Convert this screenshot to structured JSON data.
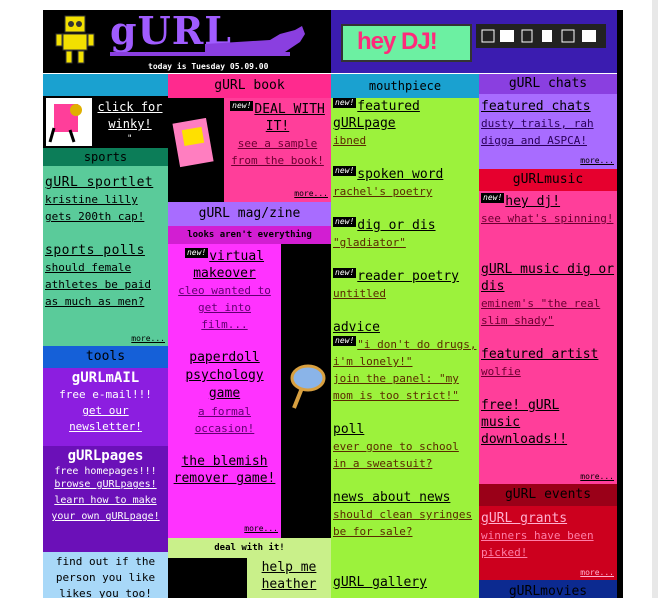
{
  "logo": {
    "text": "gURL",
    "date": "today is Tuesday 05.09.00"
  },
  "heydj": {
    "banner": "hey DJ!"
  },
  "colors": {
    "purple": "#7b35d8",
    "blue": "#1aa1d0",
    "pink": "#ff3e9a",
    "green": "#9cf23c",
    "red": "#e6002e",
    "navy": "#0c2a90",
    "magenta": "#ff32ff",
    "lime": "#c9f08a"
  },
  "winky": {
    "link": "click for winky!",
    "mark": "\""
  },
  "sports": {
    "header": "sports",
    "item1_title": "gURL sportlet",
    "item1_text": "kristine lilly gets 200th cap!",
    "item2_title": "sports polls",
    "item2_text": "should female athletes be paid as much as men?",
    "more": "more..."
  },
  "tools": {
    "header": "tools",
    "gurlmail_title": "gURLmAIL",
    "gurlmail_text": "free e-mail!!!",
    "newsletter_link": "get our newsletter!",
    "gurlpages_title": "gURLpages",
    "gurlpages_text": "free homepages!!!",
    "browse_link": "browse gURLpages!",
    "learn_link": "learn how to make your own gURLpage!",
    "find_text": "find out if the person you like likes you too!"
  },
  "book": {
    "header": "gURL book",
    "new": "new!",
    "deal_title": "DEAL WITH IT!",
    "sample_link": "see a sample from the book!",
    "more": "more..."
  },
  "magzine": {
    "header": "gURL mag/zine",
    "sub": "looks aren't everything",
    "item1_title": "virtual makeover",
    "item1_text": "cleo wanted to get into film...",
    "item2_title": "paperdoll psychology game",
    "item2_text": "a formal occasion!",
    "item3_title": "the blemish remover game!",
    "more": "more...",
    "deal_header": "deal with it!",
    "deal_link": "help me heather"
  },
  "mouthpiece": {
    "header": "mouthpiece",
    "new": "new!",
    "i1_title": "featured gURLpage",
    "i1_text": "ibned",
    "i2_title": "spoken word",
    "i2_text": "rachel's poetry",
    "i3_title": "dig or dis",
    "i3_text": "\"gladiator\"",
    "i4_title": "reader poetry",
    "i4_text": "untitled",
    "i5_title": "advice",
    "i5_text1": "\"i don't do drugs, i'm lonely!\"",
    "i5_text2": "join the panel: \"my mom is too strict!\"",
    "i6_title": "poll",
    "i6_text": "ever gone to school in a sweatsuit?",
    "i7_title": "news about news",
    "i7_text": "should clean syringes be for sale?",
    "i8_title": "gURL gallery"
  },
  "chats": {
    "header": "gURL chats",
    "title": "featured chats",
    "text": "dusty trails, rah digga and ASPCA!",
    "more": "more..."
  },
  "music": {
    "header": "gURLmusic",
    "new": "new!",
    "i1_title": "hey dj!",
    "i1_text": "see what's spinning!",
    "i2_title": "gURL music dig or dis",
    "i2_text": "eminem's \"the real slim shady\"",
    "i3_title": "featured artist",
    "i3_text": "wolfie",
    "i4_title": "free! gURL music downloads!!",
    "more": "more..."
  },
  "events": {
    "header": "gURL events",
    "title": "gURL grants",
    "text": "winners have been picked!",
    "more": "more..."
  },
  "movies": {
    "header": "gURLmovies"
  }
}
